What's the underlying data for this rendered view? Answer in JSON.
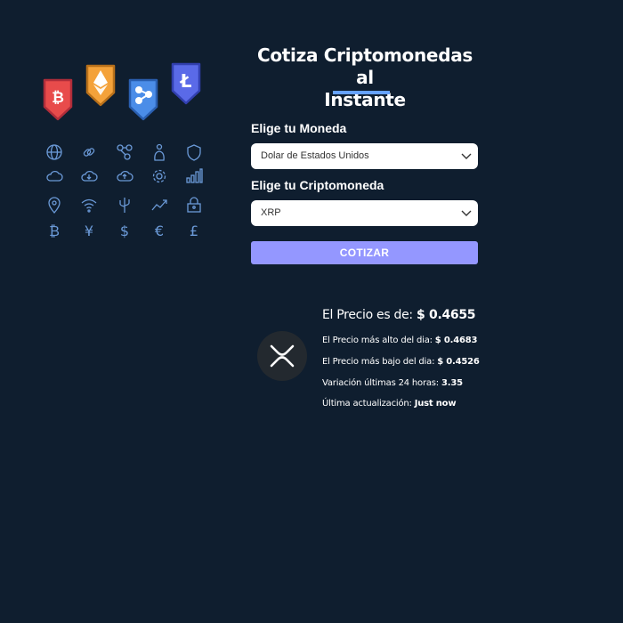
{
  "app": {
    "title_line1": "Cotiza Criptomonedas al",
    "title_line2": "Instante"
  },
  "form": {
    "currency_label": "Elige tu Moneda",
    "currency_value": "Dolar de Estados Unidos",
    "crypto_label": "Elige tu Criptomoneda",
    "crypto_value": "XRP",
    "submit_label": "COTIZAR"
  },
  "result": {
    "coin_icon": "xrp-logo-icon",
    "price_label": "El Precio es de:",
    "price_value": "$ 0.4655",
    "high_label": "El Precio más alto del dia:",
    "high_value": "$ 0.4683",
    "low_label": "El Precio más bajo del dia:",
    "low_value": "$ 0.4526",
    "change_label": "Variación últimas 24 horas:",
    "change_value": "3.35",
    "updated_label": "Última actualización:",
    "updated_value": "Just now"
  },
  "illustration": {
    "shields": [
      "bitcoin-shield-icon",
      "ethereum-shield-icon",
      "xrp-shield-icon",
      "litecoin-shield-icon"
    ],
    "shield_colors": [
      "#e84b4b",
      "#f4a23a",
      "#4b8de8",
      "#5a6ae8"
    ],
    "grid_icons": [
      "globe-icon",
      "link-icon",
      "network-icon",
      "wallet-icon",
      "shield-icon",
      "cloud-icon",
      "cloud-download-icon",
      "cloud-upload-icon",
      "gear-icon",
      "bar-chart-icon",
      "location-pin-icon",
      "wifi-icon",
      "usb-icon",
      "trend-up-icon",
      "lock-icon",
      "bitcoin-icon",
      "yen-icon",
      "dollar-icon",
      "euro-icon",
      "pound-icon"
    ],
    "currency_glyphs": [
      "₿",
      "¥",
      "$",
      "€",
      "£"
    ]
  },
  "colors": {
    "background": "#0f1e2f",
    "accent": "#66a2fe",
    "button": "#9497ff",
    "icon_stroke": "#6b9ad8"
  }
}
